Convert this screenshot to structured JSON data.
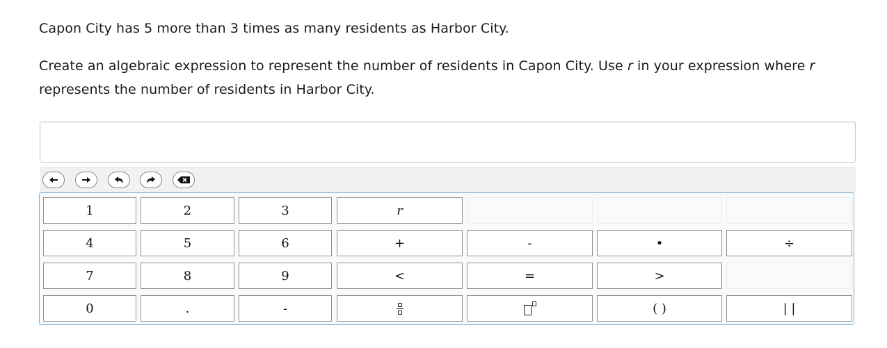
{
  "question": {
    "line1": "Capon City has 5 more than 3 times as many residents as Harbor City.",
    "line2_part1": "Create an algebraic expression to represent the number of residents in Capon City. Use ",
    "line2_var1": "r",
    "line2_part2": " in your expression where ",
    "line2_var2": "r",
    "line2_part3": " represents the number of residents in Harbor City."
  },
  "answer": {
    "value": ""
  },
  "toolbar": {
    "buttons": [
      "arrow-left-icon",
      "arrow-right-icon",
      "undo-icon",
      "redo-icon",
      "backspace-icon"
    ]
  },
  "keypad": {
    "row1": [
      "1",
      "2",
      "3",
      "r"
    ],
    "row2": [
      "4",
      "5",
      "6",
      "+",
      "-",
      "•",
      "÷"
    ],
    "row3": [
      "7",
      "8",
      "9",
      "<",
      "=",
      ">"
    ],
    "row4": [
      "0",
      ".",
      "-",
      "( )",
      "| |"
    ],
    "row4_icons": [
      "fraction-icon",
      "exponent-icon"
    ]
  },
  "colors": {
    "keypad_border": "#6fb1e0",
    "key_border": "#8f8f8f",
    "toolbar_bg": "#f1f1f1"
  }
}
